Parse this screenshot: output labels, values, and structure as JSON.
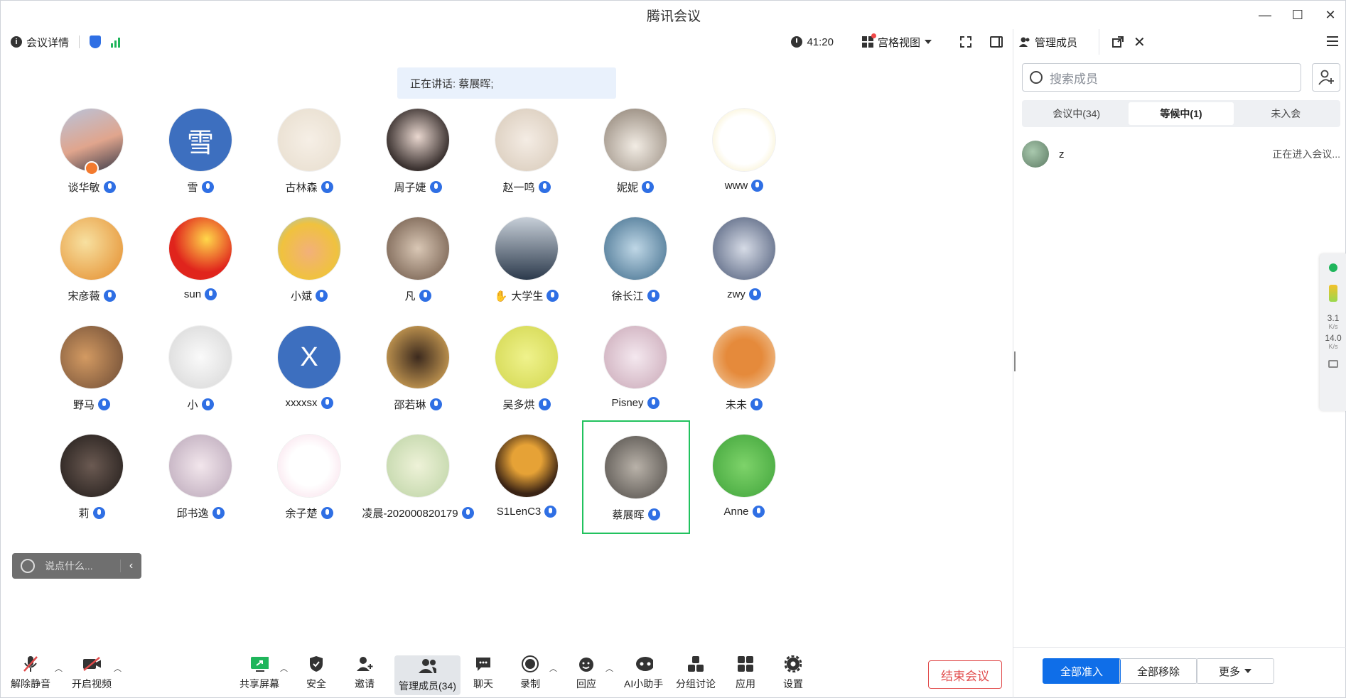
{
  "window": {
    "title": "腾讯会议",
    "controls": [
      "—",
      "☐",
      "✕"
    ]
  },
  "infobar": {
    "details_label": "会议详情",
    "timer": "41:20",
    "view_label": "宫格视图"
  },
  "speaking_label": "正在讲话: 蔡展晖;",
  "participants": [
    {
      "name": "谈华敏",
      "avatar": "photo-sunset",
      "host": true
    },
    {
      "name": "雪",
      "avatar": "letter",
      "letter": "雪"
    },
    {
      "name": "古林森",
      "avatar": "photo-cats"
    },
    {
      "name": "周子婕",
      "avatar": "photo-girl"
    },
    {
      "name": "赵一鸣",
      "avatar": "photo-anime-boy"
    },
    {
      "name": "妮妮",
      "avatar": "photo-kitten"
    },
    {
      "name": "www",
      "avatar": "photo-sunflower"
    },
    {
      "name": "宋彦薇",
      "avatar": "photo-orange"
    },
    {
      "name": "sun",
      "avatar": "photo-flag"
    },
    {
      "name": "小斌",
      "avatar": "photo-cartoon-boy"
    },
    {
      "name": "凡",
      "avatar": "photo-girl-book"
    },
    {
      "name": "大学生",
      "avatar": "photo-city",
      "hand": "✋"
    },
    {
      "name": "徐长江",
      "avatar": "photo-anime"
    },
    {
      "name": "zwy",
      "avatar": "photo-anime-girl"
    },
    {
      "name": "野马",
      "avatar": "photo-cat-orange"
    },
    {
      "name": "小",
      "avatar": "photo-dog"
    },
    {
      "name": "xxxxsx",
      "avatar": "letter",
      "letter": "X"
    },
    {
      "name": "邵若琳",
      "avatar": "photo-dark-cat"
    },
    {
      "name": "吴多烘",
      "avatar": "photo-green-face"
    },
    {
      "name": "Pisney",
      "avatar": "photo-anime-white"
    },
    {
      "name": "未未",
      "avatar": "photo-tiger"
    },
    {
      "name": "莉",
      "avatar": "photo-dark-girl"
    },
    {
      "name": "邱书逸",
      "avatar": "photo-drawn-girl"
    },
    {
      "name": "余子楚",
      "avatar": "photo-blob"
    },
    {
      "name": "凌晨-202000820179",
      "avatar": "photo-landscape"
    },
    {
      "name": "S1LenC3",
      "avatar": "photo-man"
    },
    {
      "name": "蔡展晖",
      "avatar": "photo-grumpy-cat",
      "speaking": true
    },
    {
      "name": "Anne",
      "avatar": "photo-frog"
    }
  ],
  "chat_float": {
    "placeholder": "说点什么..."
  },
  "toolbar": {
    "unmute": "解除静音",
    "video": "开启视频",
    "share": "共享屏幕",
    "security": "安全",
    "invite": "邀请",
    "members": "管理成员(34)",
    "chat": "聊天",
    "record": "录制",
    "react": "回应",
    "ai": "AI小助手",
    "breakout": "分组讨论",
    "apps": "应用",
    "settings": "设置",
    "end": "结束会议"
  },
  "side": {
    "title": "管理成员",
    "search_placeholder": "搜索成员",
    "tabs": [
      {
        "label": "会议中(34)"
      },
      {
        "label": "等候中(1)",
        "active": true
      },
      {
        "label": "未入会"
      }
    ],
    "waiting": [
      {
        "name": "z",
        "status": "正在进入会议..."
      }
    ],
    "buttons": {
      "admit_all": "全部准入",
      "remove_all": "全部移除",
      "more": "更多"
    }
  },
  "network": {
    "up": "3.1",
    "up_unit": "K/s",
    "down": "14.0",
    "down_unit": "K/s"
  },
  "colors": {
    "primary": "#0f6ee8",
    "danger": "#e14b4b",
    "active_border": "#21c25e",
    "letter_avatar": "#3d6fbf"
  }
}
